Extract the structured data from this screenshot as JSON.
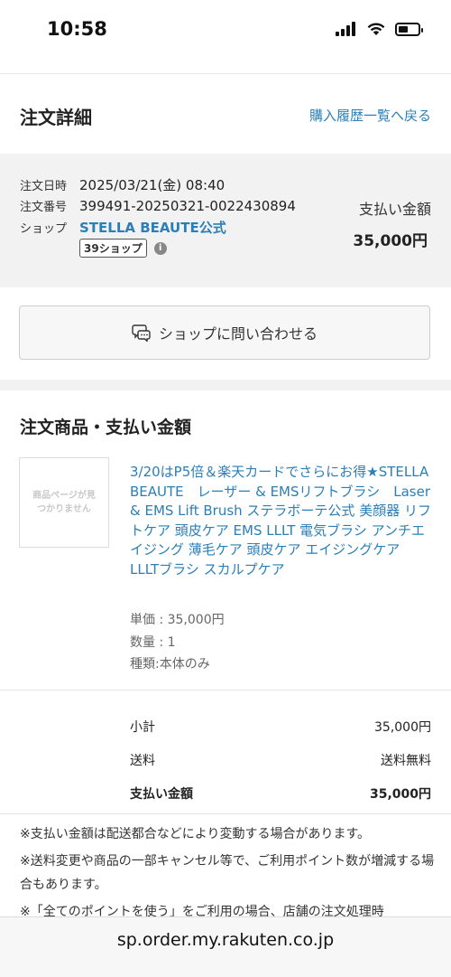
{
  "status": {
    "time": "10:58"
  },
  "header": {
    "title": "注文詳細",
    "back_link": "購入履歴一覧へ戻る"
  },
  "order": {
    "date_label": "注文日時",
    "date_value": "2025/03/21(金) 08:40",
    "number_label": "注文番号",
    "number_value": "399491-20250321-0022430894",
    "shop_label": "ショップ",
    "shop_value": "STELLA BEAUTE公式",
    "badge": "39ショップ",
    "info_icon": "i",
    "pay_label": "支払い金額",
    "pay_amount": "35,000円"
  },
  "contact": {
    "label": "ショップに問い合わせる"
  },
  "items_section": {
    "title": "注文商品・支払い金額",
    "thumb_text": "商品ページが見つかりません",
    "product_name": "3/20はP5倍＆楽天カードでさらにお得★STELLA BEAUTE　レーザー & EMSリフトブラシ　Laser & EMS Lift Brush ステラボーテ公式 美顔器 リフトケア 頭皮ケア EMS LLLT 電気ブラシ アンチエイジング 薄毛ケア 頭皮ケア エイジングケア　LLLTブラシ スカルプケア",
    "unit_price": "単価 : 35,000円",
    "quantity": "数量 : 1",
    "variant": "種類:本体のみ"
  },
  "totals": {
    "subtotal_label": "小計",
    "subtotal_value": "35,000円",
    "shipping_label": "送料",
    "shipping_value": "送料無料",
    "total_label": "支払い金額",
    "total_value": "35,000円"
  },
  "notes": [
    "※支払い金額は配送都合などにより変動する場合があります。",
    "※送料変更や商品の一部キャンセル等で、ご利用ポイント数が増減する場合もあります。",
    "※「全てのポイントを使う」をご利用の場合、店舗の注文処理時"
  ],
  "browser": {
    "url": "sp.order.my.rakuten.co.jp"
  }
}
